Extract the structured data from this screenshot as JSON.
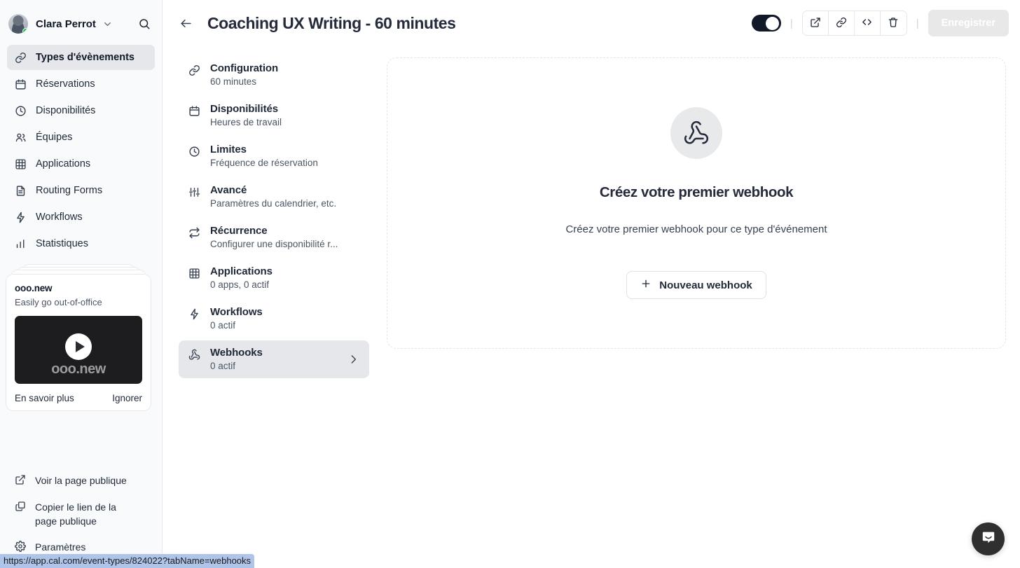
{
  "sidebar": {
    "user": {
      "name": "Clara Perrot",
      "status_color": "#22c55e"
    },
    "search_label": "search-icon",
    "nav": [
      {
        "label": "Types d'évènements",
        "icon": "link-icon",
        "active": true
      },
      {
        "label": "Réservations",
        "icon": "calendar-icon",
        "active": false
      },
      {
        "label": "Disponibilités",
        "icon": "clock-icon",
        "active": false
      },
      {
        "label": "Équipes",
        "icon": "users-icon",
        "active": false
      },
      {
        "label": "Applications",
        "icon": "grid-icon",
        "active": false
      },
      {
        "label": "Routing Forms",
        "icon": "document-icon",
        "active": false
      },
      {
        "label": "Workflows",
        "icon": "bolt-icon",
        "active": false
      },
      {
        "label": "Statistiques",
        "icon": "bar-chart-icon",
        "active": false
      }
    ],
    "promo": {
      "title": "ooo.new",
      "subtitle": "Easily go out-of-office",
      "video_caption": "ooo.new",
      "learn_more": "En savoir plus",
      "dismiss": "Ignorer"
    },
    "bottom_links": [
      {
        "label": "Voir la page publique",
        "icon": "external-link-icon"
      },
      {
        "label": "Copier le lien de la page publique",
        "icon": "copy-icon"
      },
      {
        "label": "Paramètres",
        "icon": "gear-icon"
      }
    ]
  },
  "header": {
    "title": "Coaching UX Writing - 60 minutes",
    "back_label": "back-arrow-icon",
    "toggle_on": true,
    "actions": [
      {
        "name": "preview-button",
        "icon": "external-link-icon"
      },
      {
        "name": "copy-link-button",
        "icon": "link-icon"
      },
      {
        "name": "embed-button",
        "icon": "code-icon"
      },
      {
        "name": "delete-button",
        "icon": "trash-icon"
      }
    ],
    "save_label": "Enregistrer"
  },
  "tabs": [
    {
      "label": "Configuration",
      "desc": "60 minutes",
      "icon": "link-icon",
      "active": false
    },
    {
      "label": "Disponibilités",
      "desc": "Heures de travail",
      "icon": "calendar-icon",
      "active": false
    },
    {
      "label": "Limites",
      "desc": "Fréquence de réservation",
      "icon": "clock-icon",
      "active": false
    },
    {
      "label": "Avancé",
      "desc": "Paramètres du calendrier, etc.",
      "icon": "sliders-icon",
      "active": false
    },
    {
      "label": "Récurrence",
      "desc": "Configurer une disponibilité r...",
      "icon": "repeat-icon",
      "active": false
    },
    {
      "label": "Applications",
      "desc": "0 apps, 0 actif",
      "icon": "grid-icon",
      "active": false
    },
    {
      "label": "Workflows",
      "desc": "0 actif",
      "icon": "bolt-icon",
      "active": false
    },
    {
      "label": "Webhooks",
      "desc": "0 actif",
      "icon": "webhook-icon",
      "active": true
    }
  ],
  "main": {
    "empty_icon": "webhook-icon",
    "empty_title": "Créez votre premier webhook",
    "empty_subtitle": "Créez votre premier webhook pour ce type d'événement",
    "new_webhook_label": "Nouveau webhook",
    "plus_icon": "plus-icon"
  },
  "intercom": {
    "name": "intercom-launcher",
    "icon": "chat-bubble-icon"
  },
  "statusbar": {
    "url": "https://app.cal.com/event-types/824022?tabName=webhooks"
  }
}
